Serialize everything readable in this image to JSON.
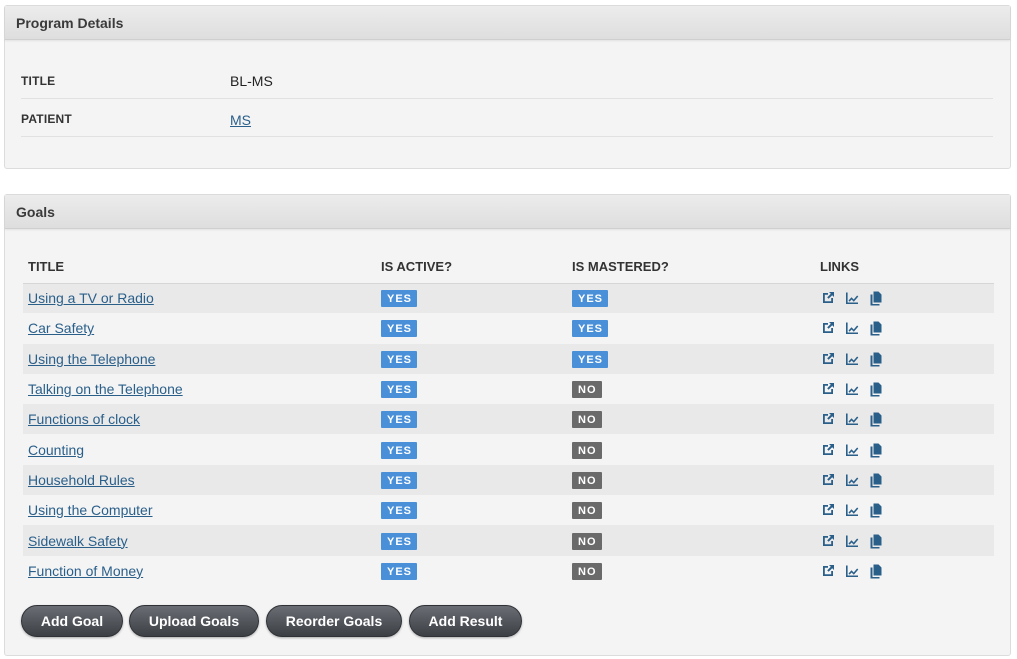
{
  "details_panel": {
    "title": "Program Details",
    "rows": [
      {
        "label": "TITLE",
        "value": "BL-MS"
      },
      {
        "label": "PATIENT",
        "value": "MS"
      }
    ]
  },
  "goals_panel": {
    "title": "Goals",
    "columns": [
      "TITLE",
      "IS ACTIVE?",
      "IS MASTERED?",
      "LINKS"
    ],
    "rows": [
      {
        "title": "Using a TV or Radio",
        "active": "YES",
        "mastered": "YES"
      },
      {
        "title": "Car Safety",
        "active": "YES",
        "mastered": "YES"
      },
      {
        "title": "Using the Telephone",
        "active": "YES",
        "mastered": "YES"
      },
      {
        "title": "Talking on the Telephone",
        "active": "YES",
        "mastered": "NO"
      },
      {
        "title": "Functions of clock",
        "active": "YES",
        "mastered": "NO"
      },
      {
        "title": "Counting",
        "active": "YES",
        "mastered": "NO"
      },
      {
        "title": "Household Rules",
        "active": "YES",
        "mastered": "NO"
      },
      {
        "title": "Using the Computer",
        "active": "YES",
        "mastered": "NO"
      },
      {
        "title": "Sidewalk Safety",
        "active": "YES",
        "mastered": "NO"
      },
      {
        "title": "Function of Money",
        "active": "YES",
        "mastered": "NO"
      }
    ],
    "link_icons": [
      "external-link-icon",
      "chart-icon",
      "copy-icon"
    ],
    "buttons": {
      "add_goal": "Add Goal",
      "upload_goals": "Upload Goals",
      "reorder_goals": "Reorder Goals",
      "add_result": "Add Result"
    }
  },
  "colors": {
    "yes_badge": "#4a90d9",
    "no_badge": "#6a6a6a",
    "link": "#2a5f8a"
  }
}
